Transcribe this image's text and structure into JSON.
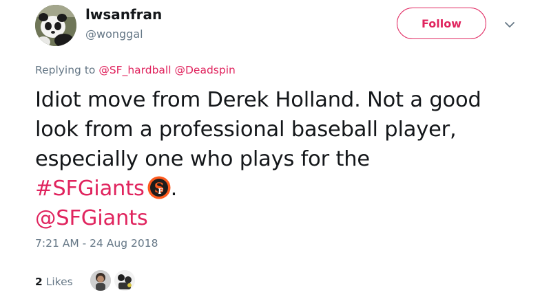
{
  "author": {
    "display_name": "lwsanfran",
    "handle": "@wonggal",
    "avatar_icon": "panda-avatar"
  },
  "follow_button": {
    "label": "Follow",
    "color": "#e0245e"
  },
  "menu": {
    "icon": "chevron-down-icon"
  },
  "reply_context": {
    "prefix": "Replying to ",
    "mentions": [
      "@SF_hardball",
      "@Deadspin"
    ]
  },
  "tweet": {
    "lines": [
      "Idiot move from Derek Holland. Not a good",
      "look from a professional baseball player,",
      "especially one who plays for the"
    ],
    "hashtag": "#SFGiants",
    "emoji_icon": "sf-giants-logo",
    "after_emoji": ".",
    "mention": "@SFGiants"
  },
  "timestamp": "7:21 AM - 24 Aug 2018",
  "likes": {
    "count": "2",
    "label": " Likes"
  },
  "colors": {
    "accent": "#e0245e",
    "secondary_text": "#657786",
    "primary_text": "#14171a",
    "giants_orange": "#fd5a1e"
  }
}
